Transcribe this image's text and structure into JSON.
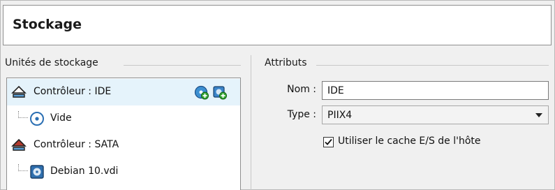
{
  "header": {
    "title": "Stockage"
  },
  "storage_units": {
    "legend": "Unités de stockage",
    "tree": [
      {
        "label": "Contrôleur : IDE",
        "icon": "ide-controller-icon",
        "selected": true
      },
      {
        "label": "Vide",
        "icon": "optical-disc-icon"
      },
      {
        "label": "Contrôleur : SATA",
        "icon": "sata-controller-icon"
      },
      {
        "label": "Debian 10.vdi",
        "icon": "hard-disk-icon"
      }
    ],
    "actions": [
      {
        "icon": "add-optical-drive-icon"
      },
      {
        "icon": "add-hard-disk-icon"
      }
    ]
  },
  "attributes": {
    "legend": "Attributs",
    "name_label": "Nom :",
    "name_value": "IDE",
    "type_label": "Type :",
    "type_value": "PIIX4",
    "cache_label": "Utiliser le cache E/S de l'hôte",
    "cache_checked": true
  },
  "colors": {
    "selection": "#e5f3fb",
    "accent_green": "#2e9b2e",
    "accent_blue": "#2b6fb3"
  }
}
